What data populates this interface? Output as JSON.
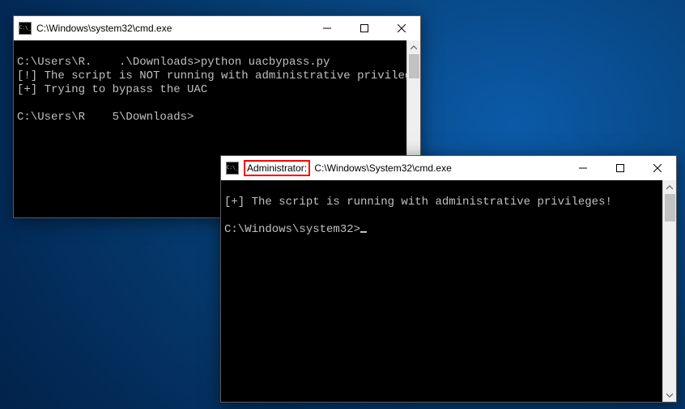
{
  "win1": {
    "title": "C:\\Windows\\system32\\cmd.exe",
    "lines": {
      "l0": "C:\\Users\\R.    .\\Downloads>python uacbypass.py",
      "l1": "[!] The script is NOT running with administrative privileges",
      "l2": "[+] Trying to bypass the UAC",
      "l3": "",
      "l4": "C:\\Users\\R    5\\Downloads>"
    }
  },
  "win2": {
    "title_admin": "Administrator:",
    "title_rest": " C:\\Windows\\System32\\cmd.exe",
    "lines": {
      "l0": "[+] The script is running with administrative privileges!",
      "l1": "",
      "l2": "C:\\Windows\\system32>"
    }
  },
  "ctrl": {
    "min": "Minimize",
    "max": "Maximize",
    "close": "Close"
  }
}
